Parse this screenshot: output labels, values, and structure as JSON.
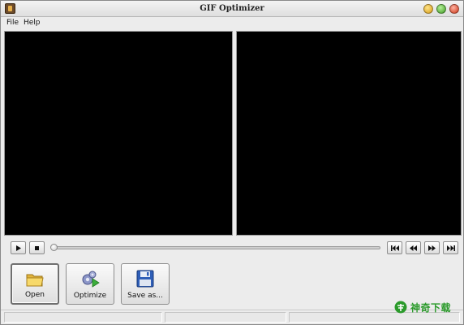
{
  "window": {
    "title": "GIF Optimizer"
  },
  "menu": {
    "items": [
      "File",
      "Help"
    ]
  },
  "toolbar": {
    "open_label": "Open",
    "optimize_label": "Optimize",
    "saveas_label": "Save as..."
  },
  "playback": {
    "position": 0
  },
  "watermark": {
    "text": "神奇下载"
  },
  "colors": {
    "preview_bg": "#000000",
    "window_bg": "#ececec",
    "watermark": "#2a9a2a"
  },
  "icons": {
    "app": "app-icon",
    "open": "folder-icon",
    "optimize": "gears-play-icon",
    "saveas": "floppy-disk-icon"
  }
}
